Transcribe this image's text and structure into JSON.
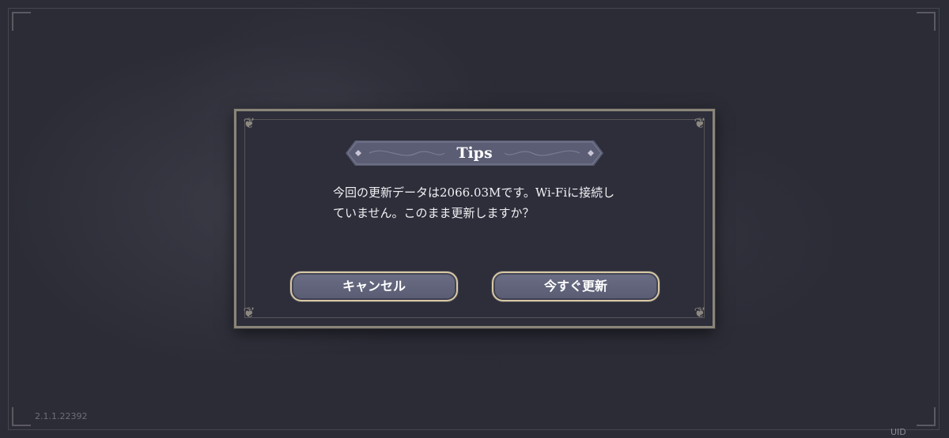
{
  "version": "2.1.1.22392",
  "uid_label": "UID",
  "dialog": {
    "title": "Tips",
    "message": "今回の更新データは2066.03Mです。Wi-Fiに接続していません。このまま更新しますか？",
    "cancel_label": "キャンセル",
    "update_label": "今すぐ更新"
  },
  "colors": {
    "background": "#2c2d37",
    "dialog_bg": "#2d2e3a",
    "button_fill": "#63667c",
    "button_border": "#d8c9a4",
    "banner_fill": "#5b5d74"
  }
}
